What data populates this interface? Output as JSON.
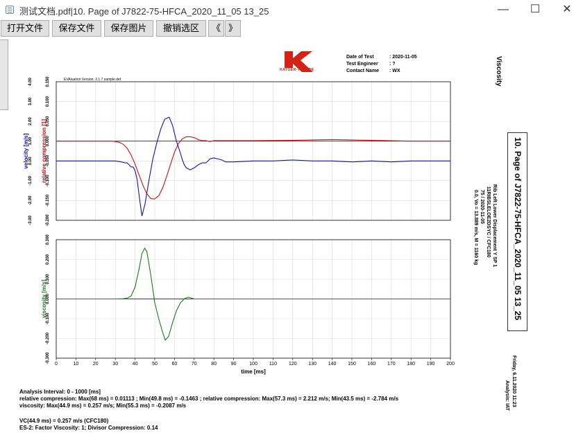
{
  "window": {
    "title": "测试文档.pdf|10. Page of J7822-75-HFCA_2020_11_05 13_25",
    "minimize_glyph": "—",
    "maximize_glyph": "☐",
    "close_glyph": "✕"
  },
  "toolbar": {
    "open_label": "打开文件",
    "save_file_label": "保存文件",
    "save_image_label": "保存图片",
    "undo_selection_label": "撤销选区",
    "prev_label": "《",
    "next_label": "》"
  },
  "report": {
    "logo_text": "KAYSER-THREDE",
    "logo_color": "#d42316",
    "info": [
      {
        "key": "Date of Test",
        "value": ": 2020-11-05"
      },
      {
        "key": "Test Engineer",
        "value": ": ?"
      },
      {
        "key": "Contact Name",
        "value": ": WX"
      }
    ],
    "heading": "Viscosity",
    "page_label": "10. Page of J7822-75-HFCA_2020_11_05 13_25",
    "description": [
      "Rib Left Lower Displacement Y SP 1",
      "11RIBSLELOE2DSYC / CFC180",
      "75 / 2020-11-05",
      "0.0, Vo = 13.889 m/s, M = 1160 kg"
    ],
    "footer_date": "Friday, 6.11.2020   11:23",
    "footer_analysis": "Analysis: IAT",
    "evaluation_version": "EVAluation Version: 2.1.7 sample.def",
    "analysis_interval": "Analysis Interval:  0 - 1000 [ms]",
    "summary_line1": "relative compression: Max(68 ms) = 0.01113  ; Min(49.8 ms) = -0.1463  ; relative compression: Max(57.3 ms) = 2.212 m/s; Min(43.5 ms) = -2.784 m/s",
    "summary_line2": "viscosity: Max(44.9 ms) = 0.257 m/s; Min(55.3 ms) = -0.2087 m/s",
    "vc_line": "VC(44.9 ms) = 0.257 m/s (CFC180)",
    "es2_line": "ES-2: Factor Viscosity: 1; Divisor Compression: 0.14"
  },
  "chart_data": [
    {
      "type": "line",
      "xlabel": "",
      "xlim": [
        0,
        200
      ],
      "grid": true,
      "axes": [
        {
          "label": "velocity [m/s]",
          "color": "#1010c0",
          "ylim": [
            -3.0,
            4.0
          ],
          "ticks": [
            "-3.00",
            "-2.00",
            "-1.00",
            "0.00",
            "1.00",
            "2.00",
            "3.00",
            "4.00"
          ]
        },
        {
          "label": "relative compression [1]",
          "color": "#cc1010",
          "ylim": [
            -0.2,
            0.15
          ],
          "ticks": [
            "-0.200",
            "-0.150",
            "-0.100",
            "-0.050",
            "0.000",
            "0.050",
            "0.100",
            "0.150"
          ]
        }
      ],
      "series": [
        {
          "axis": 1,
          "color": "#cc1010",
          "x": [
            0,
            28,
            30,
            32,
            34,
            36,
            38,
            40,
            42,
            44,
            46,
            48,
            49.8,
            52,
            54,
            56,
            58,
            60,
            62,
            64,
            66,
            68,
            70,
            72,
            74,
            76,
            78,
            80,
            84,
            90,
            100,
            120,
            140,
            160,
            180,
            200
          ],
          "y": [
            0,
            0,
            -0.001,
            -0.003,
            -0.008,
            -0.018,
            -0.035,
            -0.058,
            -0.085,
            -0.112,
            -0.133,
            -0.145,
            -0.1463,
            -0.138,
            -0.118,
            -0.09,
            -0.058,
            -0.028,
            -0.006,
            0.006,
            0.011,
            0.01113,
            0.009,
            0.004,
            0.001,
            0.001,
            -0.001,
            0.001,
            0.001,
            0.001,
            0.001,
            0.002,
            0.004,
            0.002,
            0,
            0
          ]
        },
        {
          "axis": 0,
          "color": "#1010c0",
          "x": [
            0,
            30,
            33,
            35,
            36,
            37,
            38,
            39,
            40,
            41,
            42,
            43.5,
            45,
            47,
            49,
            51,
            53,
            55,
            57.3,
            59,
            61,
            63,
            64,
            65,
            66,
            67,
            68,
            70,
            72,
            74,
            76,
            78,
            80,
            82,
            84,
            86,
            88,
            90,
            100,
            110,
            120,
            130,
            140,
            150,
            160,
            170,
            180,
            190,
            200
          ],
          "y": [
            0,
            0,
            -0.05,
            -0.1,
            -0.1,
            -0.2,
            -0.3,
            -0.3,
            -0.5,
            -0.9,
            -1.7,
            -2.784,
            -2.2,
            -1.0,
            0.1,
            0.9,
            1.6,
            2.1,
            2.212,
            1.8,
            1.0,
            0.4,
            0.05,
            -0.2,
            -0.35,
            -0.4,
            -0.45,
            -0.35,
            -0.2,
            -0.1,
            -0.1,
            0.1,
            0.15,
            0.1,
            0.05,
            -0.05,
            -0.05,
            -0.05,
            0,
            0,
            0.05,
            0,
            0,
            -0.05,
            0,
            -0.05,
            0,
            0,
            0
          ]
        }
      ]
    },
    {
      "type": "line",
      "xlabel": "time [ms]",
      "xlim": [
        0,
        200
      ],
      "xticks": [
        0,
        10,
        20,
        30,
        40,
        50,
        60,
        70,
        80,
        90,
        100,
        110,
        120,
        130,
        140,
        150,
        160,
        170,
        180,
        190,
        200
      ],
      "grid": true,
      "axes": [
        {
          "label": "viscosity [m/s]",
          "color": "#1a7a1a",
          "ylim": [
            -0.3,
            0.3
          ],
          "ticks": [
            "-0.300",
            "-0.200",
            "-0.100",
            "0.000",
            "0.100",
            "0.200",
            "0.300"
          ]
        }
      ],
      "series": [
        {
          "axis": 0,
          "color": "#1a7a1a",
          "x": [
            0,
            30,
            34,
            36,
            38,
            40,
            42,
            43.5,
            44.9,
            46,
            48,
            50,
            52,
            54,
            55.3,
            57,
            59,
            61,
            63,
            65,
            67,
            69,
            70,
            72,
            200
          ],
          "y": [
            0,
            0,
            0.001,
            0.004,
            0.015,
            0.06,
            0.15,
            0.23,
            0.257,
            0.24,
            0.12,
            -0.02,
            -0.1,
            -0.17,
            -0.2087,
            -0.19,
            -0.12,
            -0.06,
            -0.02,
            0.001,
            0.009,
            0.003,
            0,
            0,
            0
          ]
        }
      ]
    }
  ]
}
